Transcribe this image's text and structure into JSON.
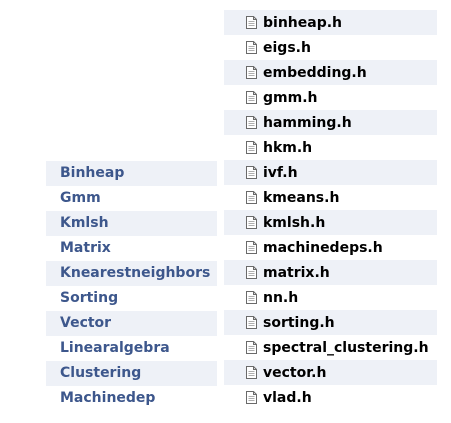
{
  "modules": [
    {
      "label": "Binheap"
    },
    {
      "label": "Gmm"
    },
    {
      "label": "Kmlsh"
    },
    {
      "label": "Matrix"
    },
    {
      "label": "Knearestneighbors"
    },
    {
      "label": "Sorting"
    },
    {
      "label": "Vector"
    },
    {
      "label": "Linearalgebra"
    },
    {
      "label": "Clustering"
    },
    {
      "label": "Machinedep"
    }
  ],
  "files": [
    {
      "name": "binheap.h"
    },
    {
      "name": "eigs.h"
    },
    {
      "name": "embedding.h"
    },
    {
      "name": "gmm.h"
    },
    {
      "name": "hamming.h"
    },
    {
      "name": "hkm.h"
    },
    {
      "name": "ivf.h"
    },
    {
      "name": "kmeans.h"
    },
    {
      "name": "kmlsh.h"
    },
    {
      "name": "machinedeps.h"
    },
    {
      "name": "matrix.h"
    },
    {
      "name": "nn.h"
    },
    {
      "name": "sorting.h"
    },
    {
      "name": "spectral_clustering.h"
    },
    {
      "name": "vector.h"
    },
    {
      "name": "vlad.h"
    }
  ],
  "icons": {
    "file": "file-document-icon"
  },
  "colors": {
    "module_link": "#3d578c",
    "row_alt_bg": "#eef1f7",
    "file_text": "#000000"
  }
}
